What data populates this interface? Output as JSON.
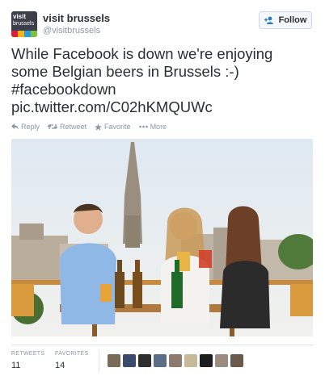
{
  "account": {
    "avatar_line1": "visit",
    "avatar_line2": "brussels",
    "display_name": "visit brussels",
    "handle": "@visitbrussels"
  },
  "follow_button": {
    "label": "Follow",
    "icon": "person-plus-icon"
  },
  "tweet": {
    "lines": [
      "While Facebook is down we're enjoying",
      "some Belgian beers in Brussels :-)",
      "#facebookdown",
      "pic.twitter.com/C02hKMQUWc"
    ]
  },
  "actions": [
    {
      "label": "Reply",
      "icon": "reply-icon"
    },
    {
      "label": "Retweet",
      "icon": "retweet-icon"
    },
    {
      "label": "Favorite",
      "icon": "star-icon"
    },
    {
      "label": "More",
      "icon": "more-dots-icon"
    }
  ],
  "stats": {
    "retweets_label": "RETWEETS",
    "retweets_value": "11",
    "favorites_label": "FAVORITES",
    "favorites_value": "14"
  },
  "favoriter_avatar_colors": [
    "#7a6a58",
    "#3b4b6b",
    "#2e2e2e",
    "#5a6e8a",
    "#8c7a6e",
    "#c8b89a",
    "#1d1d1d",
    "#9a8d80",
    "#6b5a4c"
  ],
  "colors": {
    "text": "#292f33",
    "muted": "#8899a6",
    "link_blue": "#2b7bb9",
    "border": "#ccd6dd"
  }
}
